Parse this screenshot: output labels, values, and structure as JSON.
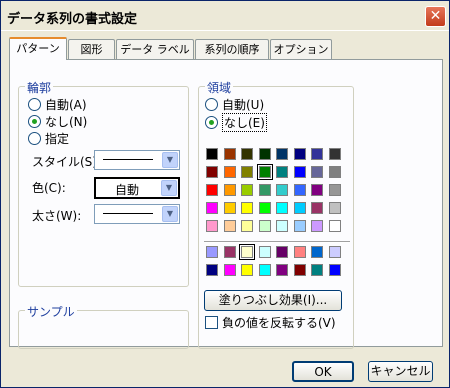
{
  "window": {
    "title": "データ系列の書式設定",
    "close_glyph": "✕"
  },
  "tabs": [
    {
      "label": "パターン"
    },
    {
      "label": "図形"
    },
    {
      "label": "データ ラベル"
    },
    {
      "label": "系列の順序"
    },
    {
      "label": "オプション"
    }
  ],
  "outline": {
    "group_label": "輪郭",
    "auto": "自動(A)",
    "none": "なし(N)",
    "custom": "指定",
    "style_label": "スタイル(S):",
    "color_label": "色(C):",
    "color_value": "自動",
    "weight_label": "太さ(W):",
    "selected": "none"
  },
  "sample": {
    "group_label": "サンプル"
  },
  "area": {
    "group_label": "領域",
    "auto": "自動(U)",
    "none": "なし(E)",
    "selected": "none",
    "palette_main": [
      [
        "#000000",
        "#993300",
        "#333300",
        "#003300",
        "#003366",
        "#000080",
        "#333399",
        "#333333"
      ],
      [
        "#800000",
        "#ff6600",
        "#808000",
        "#008000",
        "#008080",
        "#0000ff",
        "#666699",
        "#808080"
      ],
      [
        "#ff0000",
        "#ff9900",
        "#99cc00",
        "#339966",
        "#33cccc",
        "#3366ff",
        "#800080",
        "#969696"
      ],
      [
        "#ff00ff",
        "#ffcc00",
        "#ffff00",
        "#00ff00",
        "#00ffff",
        "#00ccff",
        "#993366",
        "#c0c0c0"
      ],
      [
        "#ff99cc",
        "#ffcc99",
        "#ffff99",
        "#ccffcc",
        "#ccffff",
        "#99ccff",
        "#cc99ff",
        "#ffffff"
      ]
    ],
    "palette_chart": [
      [
        "#9999ff",
        "#993366",
        "#ffffcc",
        "#ccffff",
        "#660066",
        "#ff8080",
        "#0066cc",
        "#ccccff"
      ],
      [
        "#000080",
        "#ff00ff",
        "#ffff00",
        "#00ffff",
        "#800080",
        "#800000",
        "#008080",
        "#0000ff"
      ]
    ],
    "fill_effects_button": "塗りつぶし効果(I)...",
    "invert_label": "負の値を反転する(V)"
  },
  "footer": {
    "ok": "OK",
    "cancel": "キャンセル"
  }
}
